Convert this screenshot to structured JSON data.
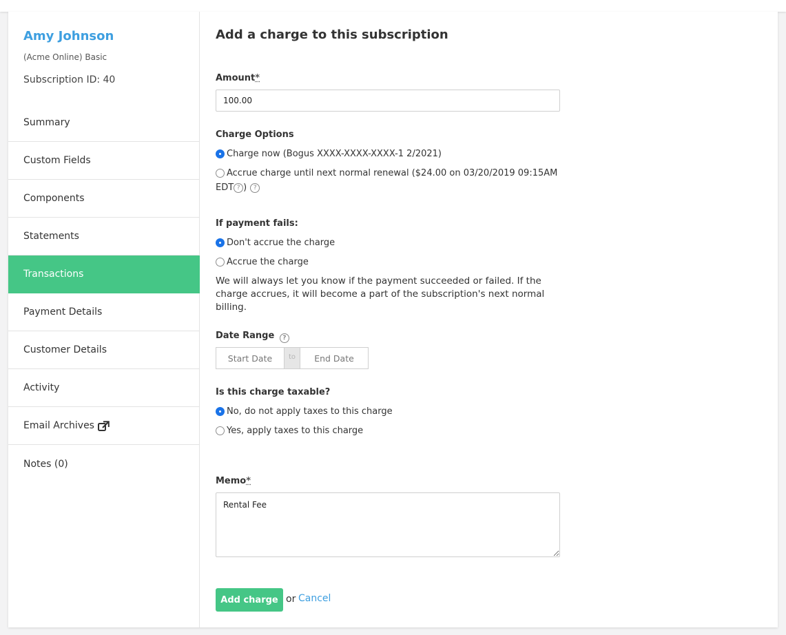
{
  "customer": {
    "name": "Amy Johnson",
    "plan": "(Acme Online) Basic",
    "subscription_id": "Subscription ID: 40"
  },
  "nav": [
    {
      "label": "Summary"
    },
    {
      "label": "Custom Fields"
    },
    {
      "label": "Components"
    },
    {
      "label": "Statements"
    },
    {
      "label": "Transactions"
    },
    {
      "label": "Payment Details"
    },
    {
      "label": "Customer Details"
    },
    {
      "label": "Activity"
    },
    {
      "label": "Email Archives"
    },
    {
      "label": "Notes (0)"
    }
  ],
  "nav_active": "Transactions",
  "form": {
    "title": "Add a charge to this subscription",
    "required_mark": "*",
    "amount": {
      "label": "Amount",
      "value": "100.00"
    },
    "charge_options": {
      "label": "Charge Options",
      "options": [
        {
          "label": "Charge now (Bogus XXXX-XXXX-XXXX-1 2/2021)",
          "selected": true
        },
        {
          "label": "Accrue charge until next normal renewal ($24.00 on 03/20/2019 09:15AM",
          "label_cont": "EDT",
          "selected": false
        }
      ]
    },
    "payment_fails": {
      "label": "If payment fails:",
      "options": [
        {
          "label": "Don't accrue the charge",
          "selected": true
        },
        {
          "label": "Accrue the charge",
          "selected": false
        }
      ],
      "note": "We will always let you know if the payment succeeded or failed. If the charge accrues, it will become a part of the subscription's next normal billing."
    },
    "date_range": {
      "label": "Date Range",
      "start_placeholder": "Start Date",
      "separator": "to",
      "end_placeholder": "End Date"
    },
    "taxable": {
      "label": "Is this charge taxable?",
      "options": [
        {
          "label": "No, do not apply taxes to this charge",
          "selected": true
        },
        {
          "label": "Yes, apply taxes to this charge",
          "selected": false
        }
      ]
    },
    "memo": {
      "label": "Memo",
      "value": "Rental Fee"
    },
    "submit_label": "Add charge",
    "or_text": "or",
    "cancel_label": "Cancel"
  },
  "colors": {
    "accent_green": "#45c686",
    "link_blue": "#3e9fe0",
    "radio_blue": "#1a73e8"
  },
  "icons": {
    "help": "question-circle-icon",
    "external_link": "external-link-icon"
  }
}
